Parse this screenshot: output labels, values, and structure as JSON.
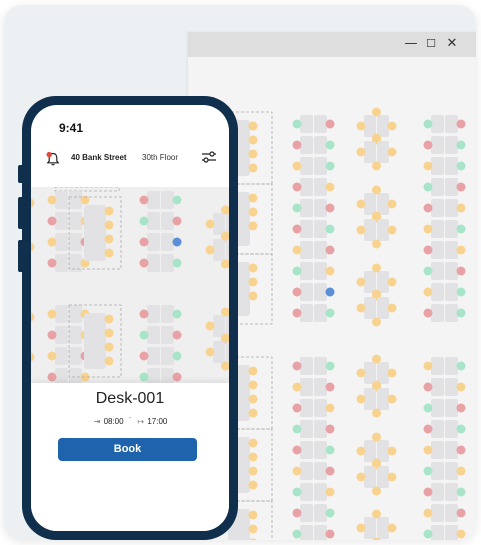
{
  "window": {
    "controls": {
      "minimize": "—",
      "maximize": "☐",
      "close": "✕"
    }
  },
  "phone": {
    "status_time": "9:41",
    "header": {
      "address": "40 Bank Street",
      "floor": "30th Floor"
    },
    "booking": {
      "desk_name": "Desk-001",
      "start_time": "08:00",
      "end_time": "17:00",
      "book_label": "Book"
    }
  },
  "colors": {
    "phone_frame": "#0f2f4c",
    "book_button": "#1f63ad",
    "seat_available": "#a8e5c8",
    "seat_booked": "#e8a2a6",
    "seat_reserved": "#f8d38f",
    "seat_selected": "#5a8fd8",
    "notification_dot": "#e04a3a"
  },
  "legend_icons": [
    "bell-icon",
    "filter-icon",
    "check-in-icon",
    "check-out-icon"
  ]
}
